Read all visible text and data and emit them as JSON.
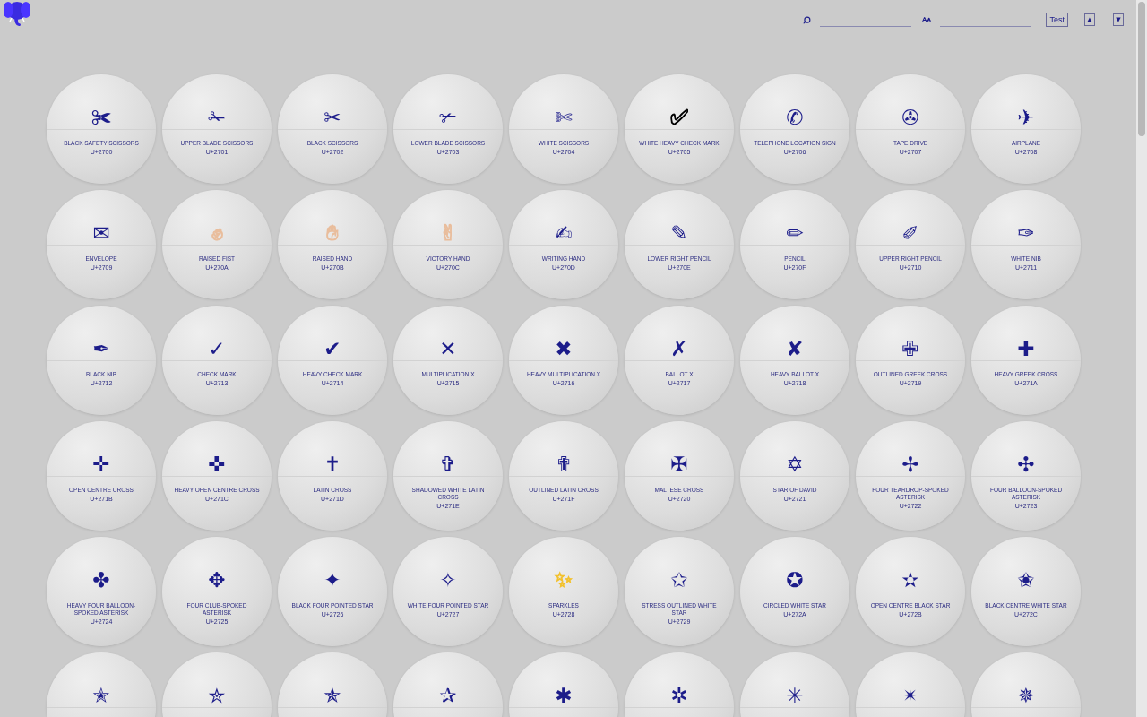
{
  "toolbar": {
    "test_button": "Test",
    "up_button": "▲",
    "down_button": "▼"
  },
  "characters": [
    {
      "glyph": "✀",
      "name": "BLACK SAFETY SCISSORS",
      "code": "U+2700"
    },
    {
      "glyph": "✁",
      "name": "UPPER BLADE SCISSORS",
      "code": "U+2701"
    },
    {
      "glyph": "✂",
      "name": "BLACK SCISSORS",
      "code": "U+2702"
    },
    {
      "glyph": "✃",
      "name": "LOWER BLADE SCISSORS",
      "code": "U+2703"
    },
    {
      "glyph": "✄",
      "name": "WHITE SCISSORS",
      "code": "U+2704"
    },
    {
      "glyph": "✅",
      "name": "WHITE HEAVY CHECK MARK",
      "code": "U+2705",
      "color": "#000000"
    },
    {
      "glyph": "✆",
      "name": "TELEPHONE LOCATION SIGN",
      "code": "U+2706"
    },
    {
      "glyph": "✇",
      "name": "TAPE DRIVE",
      "code": "U+2707"
    },
    {
      "glyph": "✈",
      "name": "AIRPLANE",
      "code": "U+2708"
    },
    {
      "glyph": "✉",
      "name": "ENVELOPE",
      "code": "U+2709"
    },
    {
      "glyph": "✊",
      "name": "RAISED FIST",
      "code": "U+270A",
      "color": "#e9bd9c"
    },
    {
      "glyph": "✋",
      "name": "RAISED HAND",
      "code": "U+270B",
      "color": "#e9bd9c"
    },
    {
      "glyph": "✌",
      "name": "VICTORY HAND",
      "code": "U+270C",
      "color": "#e9bd9c"
    },
    {
      "glyph": "✍",
      "name": "WRITING HAND",
      "code": "U+270D"
    },
    {
      "glyph": "✎",
      "name": "LOWER RIGHT PENCIL",
      "code": "U+270E"
    },
    {
      "glyph": "✏",
      "name": "PENCIL",
      "code": "U+270F"
    },
    {
      "glyph": "✐",
      "name": "UPPER RIGHT PENCIL",
      "code": "U+2710"
    },
    {
      "glyph": "✑",
      "name": "WHITE NIB",
      "code": "U+2711"
    },
    {
      "glyph": "✒",
      "name": "BLACK NIB",
      "code": "U+2712"
    },
    {
      "glyph": "✓",
      "name": "CHECK MARK",
      "code": "U+2713"
    },
    {
      "glyph": "✔",
      "name": "HEAVY CHECK MARK",
      "code": "U+2714"
    },
    {
      "glyph": "✕",
      "name": "MULTIPLICATION X",
      "code": "U+2715"
    },
    {
      "glyph": "✖",
      "name": "HEAVY MULTIPLICATION X",
      "code": "U+2716"
    },
    {
      "glyph": "✗",
      "name": "BALLOT X",
      "code": "U+2717"
    },
    {
      "glyph": "✘",
      "name": "HEAVY BALLOT X",
      "code": "U+2718"
    },
    {
      "glyph": "✙",
      "name": "OUTLINED GREEK CROSS",
      "code": "U+2719"
    },
    {
      "glyph": "✚",
      "name": "HEAVY GREEK CROSS",
      "code": "U+271A"
    },
    {
      "glyph": "✛",
      "name": "OPEN CENTRE CROSS",
      "code": "U+271B"
    },
    {
      "glyph": "✜",
      "name": "HEAVY OPEN CENTRE CROSS",
      "code": "U+271C"
    },
    {
      "glyph": "✝",
      "name": "LATIN CROSS",
      "code": "U+271D"
    },
    {
      "glyph": "✞",
      "name": "SHADOWED WHITE LATIN CROSS",
      "code": "U+271E"
    },
    {
      "glyph": "✟",
      "name": "OUTLINED LATIN CROSS",
      "code": "U+271F"
    },
    {
      "glyph": "✠",
      "name": "MALTESE CROSS",
      "code": "U+2720"
    },
    {
      "glyph": "✡",
      "name": "STAR OF DAVID",
      "code": "U+2721"
    },
    {
      "glyph": "✢",
      "name": "FOUR TEARDROP-SPOKED ASTERISK",
      "code": "U+2722"
    },
    {
      "glyph": "✣",
      "name": "FOUR BALLOON-SPOKED ASTERISK",
      "code": "U+2723"
    },
    {
      "glyph": "✤",
      "name": "HEAVY FOUR BALLOON-SPOKED ASTERISK",
      "code": "U+2724"
    },
    {
      "glyph": "✥",
      "name": "FOUR CLUB-SPOKED ASTERISK",
      "code": "U+2725"
    },
    {
      "glyph": "✦",
      "name": "BLACK FOUR POINTED STAR",
      "code": "U+2726"
    },
    {
      "glyph": "✧",
      "name": "WHITE FOUR POINTED STAR",
      "code": "U+2727"
    },
    {
      "glyph": "✨",
      "name": "SPARKLES",
      "code": "U+2728",
      "color": "#f2c12e"
    },
    {
      "glyph": "✩",
      "name": "STRESS OUTLINED WHITE STAR",
      "code": "U+2729"
    },
    {
      "glyph": "✪",
      "name": "CIRCLED WHITE STAR",
      "code": "U+272A"
    },
    {
      "glyph": "✫",
      "name": "OPEN CENTRE BLACK STAR",
      "code": "U+272B"
    },
    {
      "glyph": "✬",
      "name": "BLACK CENTRE WHITE STAR",
      "code": "U+272C"
    },
    {
      "glyph": "✭"
    },
    {
      "glyph": "✮"
    },
    {
      "glyph": "✯"
    },
    {
      "glyph": "✰"
    },
    {
      "glyph": "✱"
    },
    {
      "glyph": "✲"
    },
    {
      "glyph": "✳"
    },
    {
      "glyph": "✴"
    },
    {
      "glyph": "✵"
    }
  ]
}
